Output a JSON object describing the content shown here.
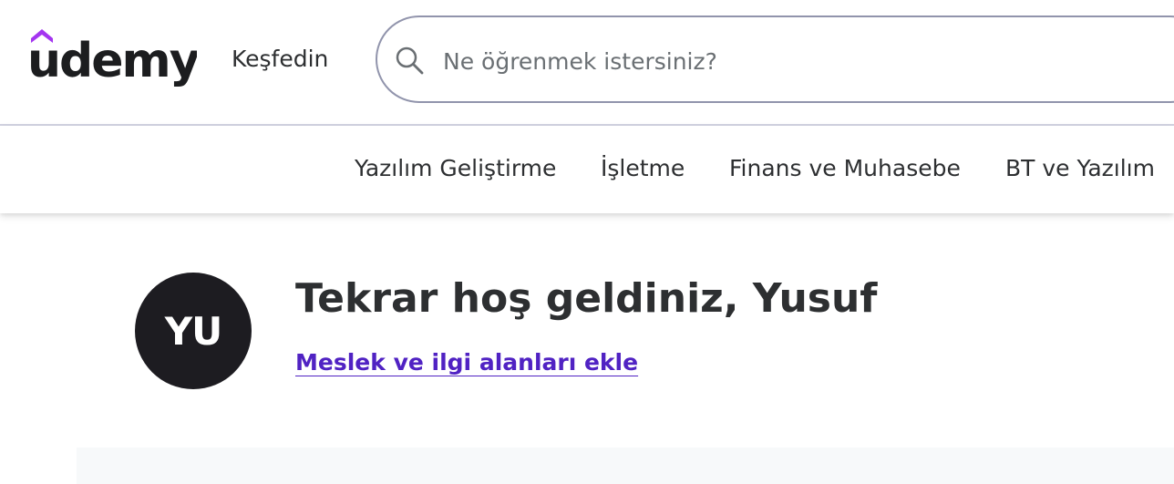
{
  "header": {
    "logo_text": "udemy",
    "explore_label": "Keşfedin",
    "search": {
      "placeholder": "Ne öğrenmek istersiniz?",
      "icon": "search-icon"
    }
  },
  "subnav": {
    "items": [
      {
        "label": "Yazılım Geliştirme"
      },
      {
        "label": "İşletme"
      },
      {
        "label": "Finans ve Muhasebe"
      },
      {
        "label": "BT ve Yazılım"
      }
    ]
  },
  "welcome": {
    "avatar_initials": "YU",
    "greeting": "Tekrar hoş geldiniz, Yusuf",
    "add_interests_link": "Meslek ve ilgi alanları ekle"
  },
  "colors": {
    "brand_purple": "#a435f0",
    "link_purple": "#5022c3",
    "text_dark": "#2d2f31",
    "avatar_bg": "#1d1c21",
    "border_gray": "#d1d2e0"
  }
}
